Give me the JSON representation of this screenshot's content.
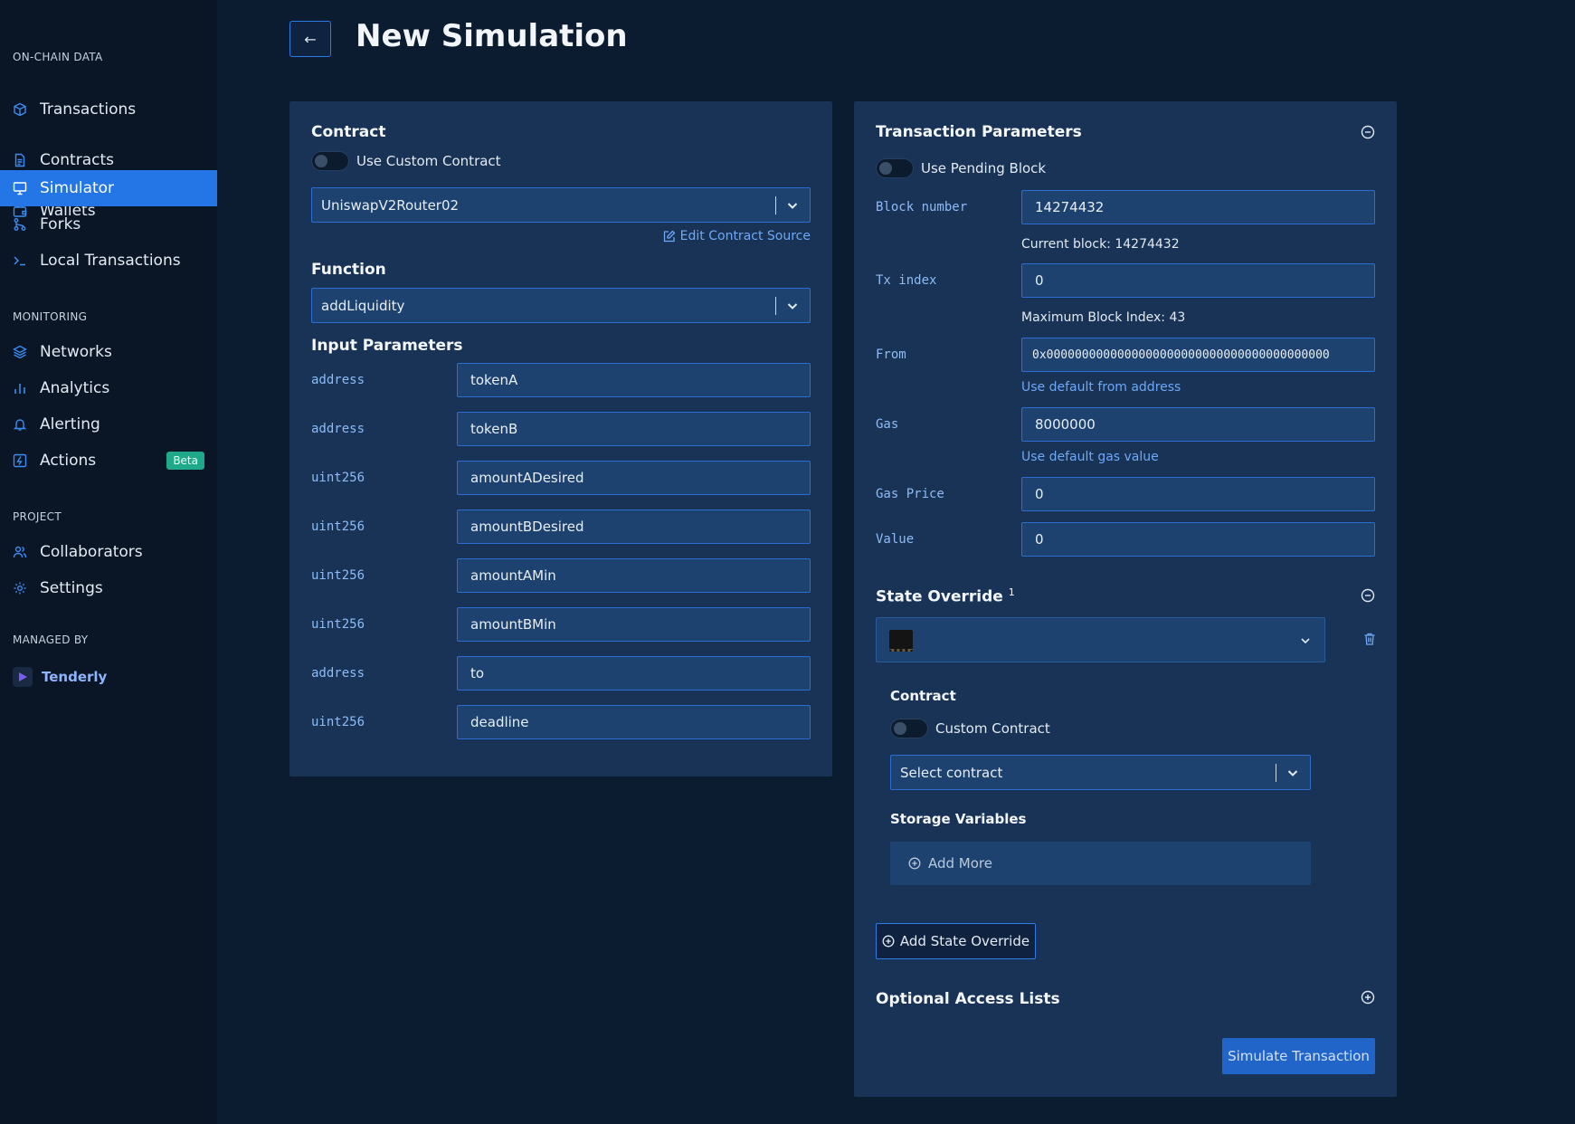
{
  "sidebar": {
    "sections": {
      "onchain": "ON-CHAIN DATA",
      "monitoring": "MONITORING",
      "project": "PROJECT",
      "managed": "MANAGED BY"
    },
    "items": [
      {
        "label": "Transactions",
        "icon": "cube-icon"
      },
      {
        "label": "Contracts",
        "icon": "document-icon"
      },
      {
        "label": "Wallets",
        "icon": "wallet-icon"
      },
      {
        "label": "Simulator",
        "icon": "monitor-icon",
        "active": true
      },
      {
        "label": "Forks",
        "icon": "fork-icon"
      },
      {
        "label": "Local Transactions",
        "icon": "terminal-icon"
      },
      {
        "label": "Networks",
        "icon": "layers-icon"
      },
      {
        "label": "Analytics",
        "icon": "bar-chart-icon"
      },
      {
        "label": "Alerting",
        "icon": "bell-icon"
      },
      {
        "label": "Actions",
        "icon": "lightning-icon",
        "badge": "Beta"
      },
      {
        "label": "Collaborators",
        "icon": "users-icon"
      },
      {
        "label": "Settings",
        "icon": "gear-icon"
      }
    ],
    "brand": "Tenderly"
  },
  "header": {
    "back_icon": "←",
    "title": "New Simulation"
  },
  "contract_panel": {
    "contract_heading": "Contract",
    "custom_toggle_label": "Use Custom Contract",
    "contract_selected": "UniswapV2Router02",
    "edit_source_link": "Edit Contract Source",
    "function_heading": "Function",
    "function_selected": "addLiquidity",
    "input_params_heading": "Input Parameters",
    "params": [
      {
        "type": "address",
        "name": "tokenA"
      },
      {
        "type": "address",
        "name": "tokenB"
      },
      {
        "type": "uint256",
        "name": "amountADesired"
      },
      {
        "type": "uint256",
        "name": "amountBDesired"
      },
      {
        "type": "uint256",
        "name": "amountAMin"
      },
      {
        "type": "uint256",
        "name": "amountBMin"
      },
      {
        "type": "address",
        "name": "to"
      },
      {
        "type": "uint256",
        "name": "deadline"
      }
    ]
  },
  "tx_panel": {
    "heading": "Transaction Parameters",
    "pending_toggle_label": "Use Pending Block",
    "block_number_label": "Block number",
    "block_number": "14274432",
    "current_block": "Current block: 14274432",
    "tx_index_label": "Tx index",
    "tx_index": "0",
    "max_block_index": "Maximum Block Index: 43",
    "from_label": "From",
    "from_value": "0x0000000000000000000000000000000000000000",
    "default_from_link": "Use default from address",
    "gas_label": "Gas",
    "gas_value": "8000000",
    "default_gas_link": "Use default gas value",
    "gas_price_label": "Gas Price",
    "gas_price": "0",
    "value_label": "Value",
    "value": "0",
    "state_override_heading": "State Override",
    "state_override_count": "1",
    "override_contract_heading": "Contract",
    "custom_contract_label": "Custom Contract",
    "select_contract": "Select contract",
    "storage_heading": "Storage Variables",
    "add_more": "Add More",
    "add_state_override": "Add State Override",
    "access_lists_heading": "Optional Access Lists",
    "simulate_button": "Simulate Transaction"
  },
  "colors": {
    "accent": "#2476e6",
    "panel": "#183355",
    "background": "#0c1c30",
    "input": "#1d4270",
    "beta": "#1fa98a"
  }
}
